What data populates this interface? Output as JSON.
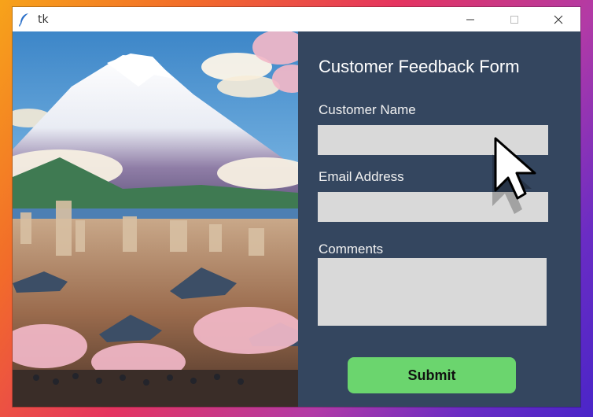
{
  "window": {
    "title": "tk",
    "controls": {
      "minimize": "minimize",
      "maximize": "maximize",
      "close": "close"
    }
  },
  "form": {
    "title": "Customer Feedback Form",
    "name_label": "Customer Name",
    "name_value": "",
    "email_label": "Email Address",
    "email_value": "",
    "comments_label": "Comments",
    "comments_value": "",
    "submit_label": "Submit"
  },
  "colors": {
    "form_bg": "#34465f",
    "field_bg": "#d9d9d9",
    "submit_bg": "#6bd56e"
  },
  "icons": [
    "feather-icon",
    "minimize-icon",
    "maximize-icon",
    "close-icon",
    "mouse-pointer-icon"
  ]
}
